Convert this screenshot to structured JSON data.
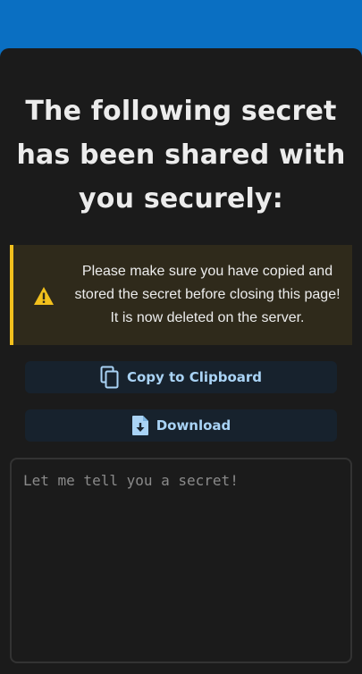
{
  "header": {
    "accent_color": "#0a6fc2"
  },
  "page": {
    "title": "The following secret has been shared with you securely:"
  },
  "warning": {
    "icon": "warning-triangle-icon",
    "color": "#f2c01d",
    "message": "Please make sure you have copied and stored the secret before closing this page! It is now deleted on the server."
  },
  "actions": {
    "copy_label": "Copy to Clipboard",
    "copy_icon": "copy-icon",
    "download_label": "Download",
    "download_icon": "file-download-icon"
  },
  "secret": {
    "placeholder": "Let me tell you a secret!",
    "value": ""
  }
}
